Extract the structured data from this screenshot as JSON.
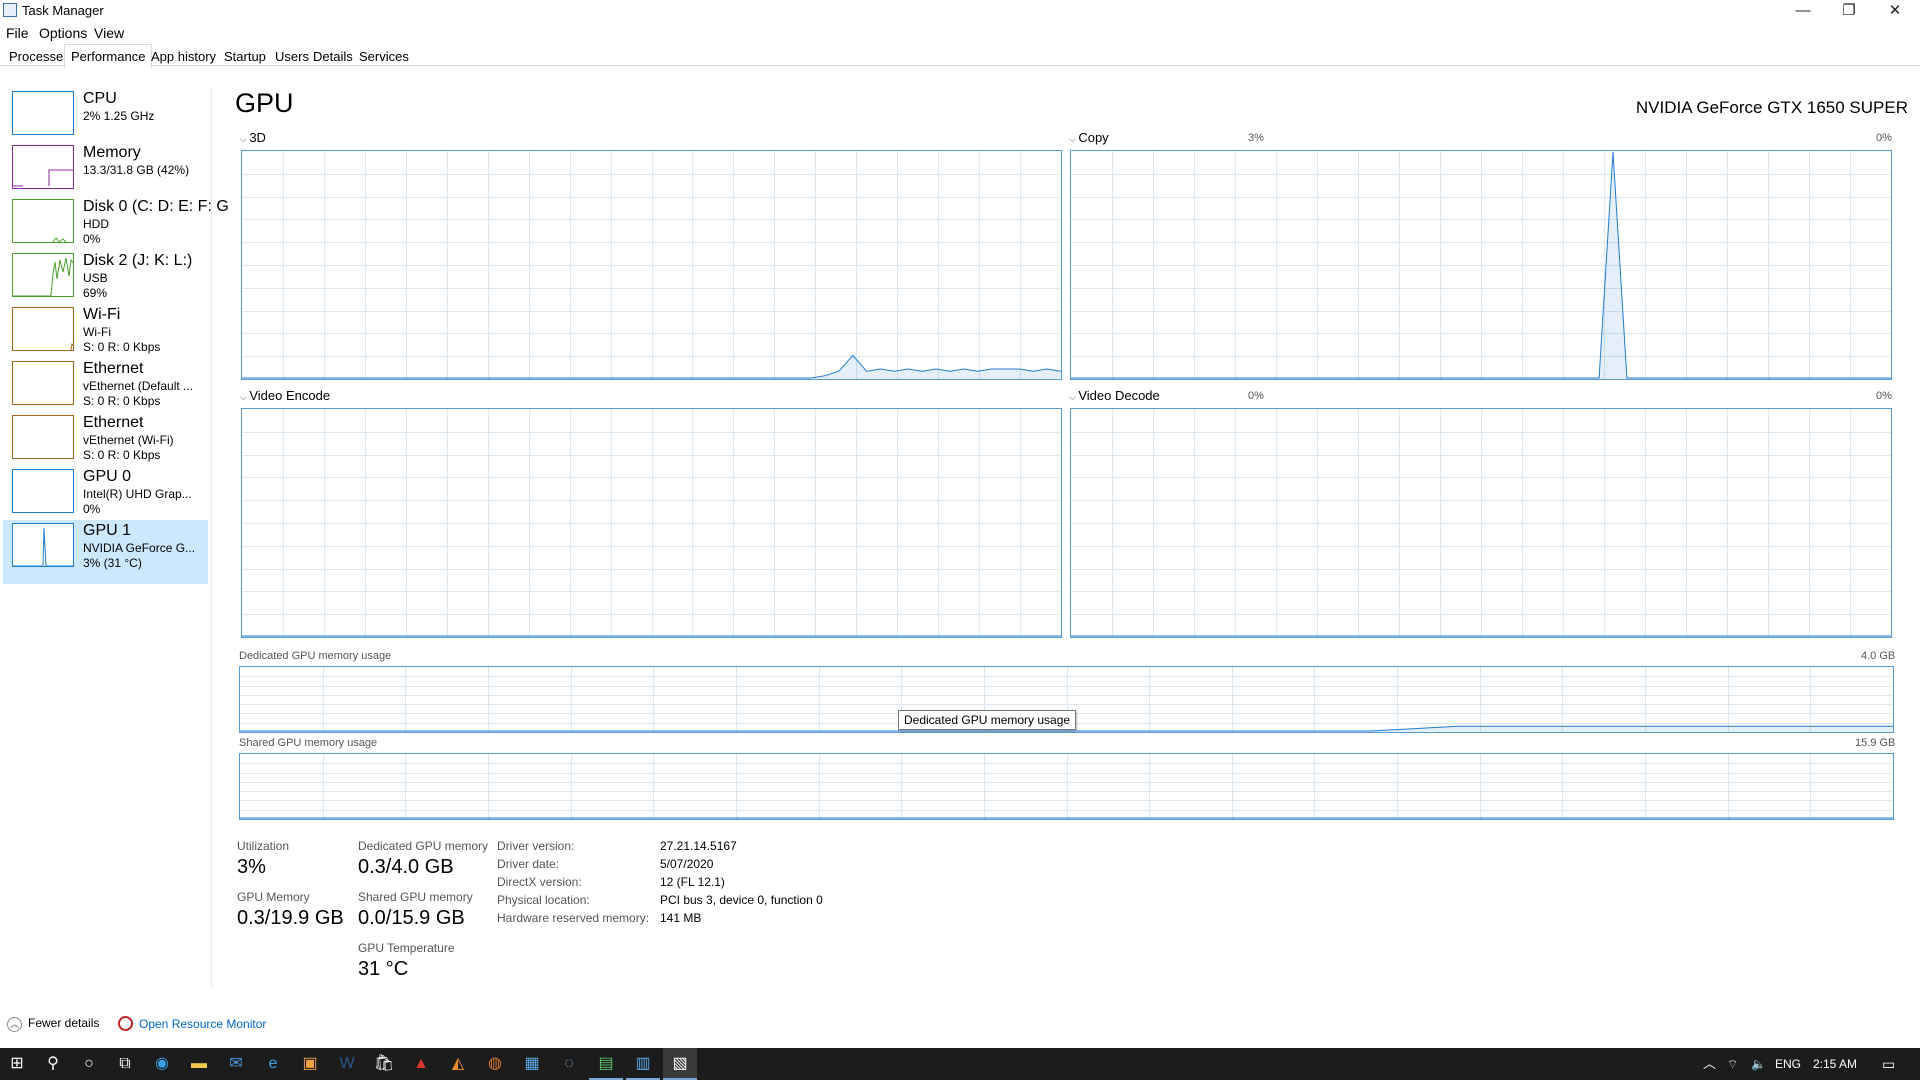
{
  "window": {
    "title": "Task Manager",
    "controls": {
      "minimize": "—",
      "restore": "❐",
      "close": "✕"
    }
  },
  "menu": [
    "File",
    "Options",
    "View"
  ],
  "tabs": [
    "Processes",
    "Performance",
    "App history",
    "Startup",
    "Users",
    "Details",
    "Services"
  ],
  "active_tab": "Performance",
  "sidebar": {
    "items": [
      {
        "name": "CPU",
        "sub1": "2% 1.25 GHz",
        "sub2": "",
        "color": "#1f7ccf",
        "selected": false
      },
      {
        "name": "Memory",
        "sub1": "13.3/31.8 GB (42%)",
        "sub2": "",
        "color": "#8b2b9e",
        "selected": false
      },
      {
        "name": "Disk 0 (C: D: E: F: G",
        "sub1": "HDD",
        "sub2": "0%",
        "color": "#4aa02c",
        "selected": false
      },
      {
        "name": "Disk 2 (J: K: L:)",
        "sub1": "USB",
        "sub2": "69%",
        "color": "#4aa02c",
        "selected": false
      },
      {
        "name": "Wi-Fi",
        "sub1": "Wi-Fi",
        "sub2": "S: 0 R: 0 Kbps",
        "color": "#a7651b",
        "selected": false
      },
      {
        "name": "Ethernet",
        "sub1": "vEthernet (Default ...",
        "sub2": "S: 0 R: 0 Kbps",
        "color": "#a7651b",
        "selected": false
      },
      {
        "name": "Ethernet",
        "sub1": "vEthernet (Wi-Fi)",
        "sub2": "S: 0 R: 0 Kbps",
        "color": "#a7651b",
        "selected": false
      },
      {
        "name": "GPU 0",
        "sub1": "Intel(R) UHD Grap...",
        "sub2": "0%",
        "color": "#1f7ccf",
        "selected": false
      },
      {
        "name": "GPU 1",
        "sub1": "NVIDIA GeForce G...",
        "sub2": "3% (31 °C)",
        "color": "#1f7ccf",
        "selected": true
      }
    ]
  },
  "main": {
    "title": "GPU",
    "model": "NVIDIA GeForce GTX 1650 SUPER",
    "engines": [
      {
        "label": "3D",
        "max": "3%"
      },
      {
        "label": "Copy",
        "max": "0%"
      },
      {
        "label": "Video Encode",
        "max": "0%"
      },
      {
        "label": "Video Decode",
        "max": "0%"
      }
    ],
    "dedicated_mem": {
      "label": "Dedicated GPU memory usage",
      "max": "4.0 GB"
    },
    "shared_mem": {
      "label": "Shared GPU memory usage",
      "max": "15.9 GB"
    },
    "tooltip": "Dedicated GPU memory usage",
    "graph_color": "#1f7ccf",
    "grid_color": "#dbe8f4"
  },
  "chart_data": [
    {
      "type": "line",
      "title": "3D",
      "ylim": [
        0,
        100
      ],
      "x": [
        0,
        1,
        2,
        3,
        4,
        5,
        6,
        7,
        8,
        9,
        10,
        11,
        12,
        13,
        14,
        15,
        16,
        17,
        18,
        19,
        20,
        21,
        22,
        23,
        24,
        25,
        26,
        27,
        28,
        29,
        30,
        31,
        32,
        33,
        34,
        35,
        36,
        37,
        38,
        39,
        40,
        41,
        42,
        43,
        44,
        45,
        46,
        47,
        48,
        49,
        50,
        51,
        52,
        53,
        54,
        55,
        56,
        57,
        58,
        59
      ],
      "values": [
        0,
        0,
        0,
        0,
        0,
        0,
        0,
        0,
        0,
        0,
        0,
        0,
        0,
        0,
        0,
        0,
        0,
        0,
        0,
        0,
        0,
        0,
        0,
        0,
        0,
        0,
        0,
        0,
        0,
        0,
        0,
        0,
        0,
        0,
        0,
        0,
        0,
        0,
        0,
        0,
        0,
        0,
        1,
        3,
        10,
        3,
        4,
        3,
        4,
        3,
        4,
        3,
        4,
        3,
        4,
        4,
        4,
        3,
        4,
        3
      ]
    },
    {
      "type": "line",
      "title": "Copy",
      "ylim": [
        0,
        100
      ],
      "x": [
        0,
        1,
        2,
        3,
        4,
        5,
        6,
        7,
        8,
        9,
        10,
        11,
        12,
        13,
        14,
        15,
        16,
        17,
        18,
        19,
        20,
        21,
        22,
        23,
        24,
        25,
        26,
        27,
        28,
        29,
        30,
        31,
        32,
        33,
        34,
        35,
        36,
        37,
        38,
        39,
        40,
        41,
        42,
        43,
        44,
        45,
        46,
        47,
        48,
        49,
        50,
        51,
        52,
        53,
        54,
        55,
        56,
        57,
        58,
        59
      ],
      "values": [
        0,
        0,
        0,
        0,
        0,
        0,
        0,
        0,
        0,
        0,
        0,
        0,
        0,
        0,
        0,
        0,
        0,
        0,
        0,
        0,
        0,
        0,
        0,
        0,
        0,
        0,
        0,
        0,
        0,
        0,
        0,
        0,
        0,
        0,
        0,
        0,
        0,
        0,
        0,
        100,
        0,
        0,
        0,
        0,
        0,
        0,
        0,
        0,
        0,
        0,
        0,
        0,
        0,
        0,
        0,
        0,
        0,
        0,
        0,
        0
      ]
    },
    {
      "type": "line",
      "title": "Video Encode",
      "ylim": [
        0,
        100
      ],
      "values": [
        0,
        0,
        0,
        0,
        0,
        0,
        0,
        0,
        0,
        0
      ]
    },
    {
      "type": "line",
      "title": "Video Decode",
      "ylim": [
        0,
        100
      ],
      "values": [
        0,
        0,
        0,
        0,
        0,
        0,
        0,
        0,
        0,
        0
      ]
    },
    {
      "type": "area",
      "title": "Dedicated GPU memory usage",
      "ylim": [
        0,
        4.0
      ],
      "x": [
        0,
        1,
        2,
        3,
        4,
        5,
        6,
        7,
        8,
        9,
        10,
        11,
        12,
        13,
        14,
        15,
        16,
        17,
        18,
        19
      ],
      "values": [
        0,
        0,
        0,
        0,
        0,
        0,
        0,
        0,
        0,
        0,
        0,
        0,
        0,
        0,
        0.3,
        0.3,
        0.3,
        0.3,
        0.3,
        0.3
      ]
    },
    {
      "type": "area",
      "title": "Shared GPU memory usage",
      "ylim": [
        0,
        15.9
      ],
      "values": [
        0,
        0,
        0,
        0,
        0,
        0,
        0,
        0,
        0,
        0
      ]
    }
  ],
  "stats": {
    "utilization": {
      "label": "Utilization",
      "value": "3%"
    },
    "gpu_memory": {
      "label": "GPU Memory",
      "value": "0.3/19.9 GB"
    },
    "dedicated": {
      "label": "Dedicated GPU memory",
      "value": "0.3/4.0 GB"
    },
    "shared": {
      "label": "Shared GPU memory",
      "value": "0.0/15.9 GB"
    },
    "temperature": {
      "label": "GPU Temperature",
      "value": "31 °C"
    }
  },
  "details": [
    {
      "label": "Driver version:",
      "value": "27.21.14.5167"
    },
    {
      "label": "Driver date:",
      "value": "5/07/2020"
    },
    {
      "label": "DirectX version:",
      "value": "12 (FL 12.1)"
    },
    {
      "label": "Physical location:",
      "value": "PCI bus 3, device 0, function 0"
    },
    {
      "label": "Hardware reserved memory:",
      "value": "141 MB"
    }
  ],
  "footer": {
    "fewer_details": "Fewer details",
    "resource_monitor": "Open Resource Monitor"
  },
  "taskbar": {
    "tray_lang": "ENG",
    "clock": "2:15 AM"
  }
}
